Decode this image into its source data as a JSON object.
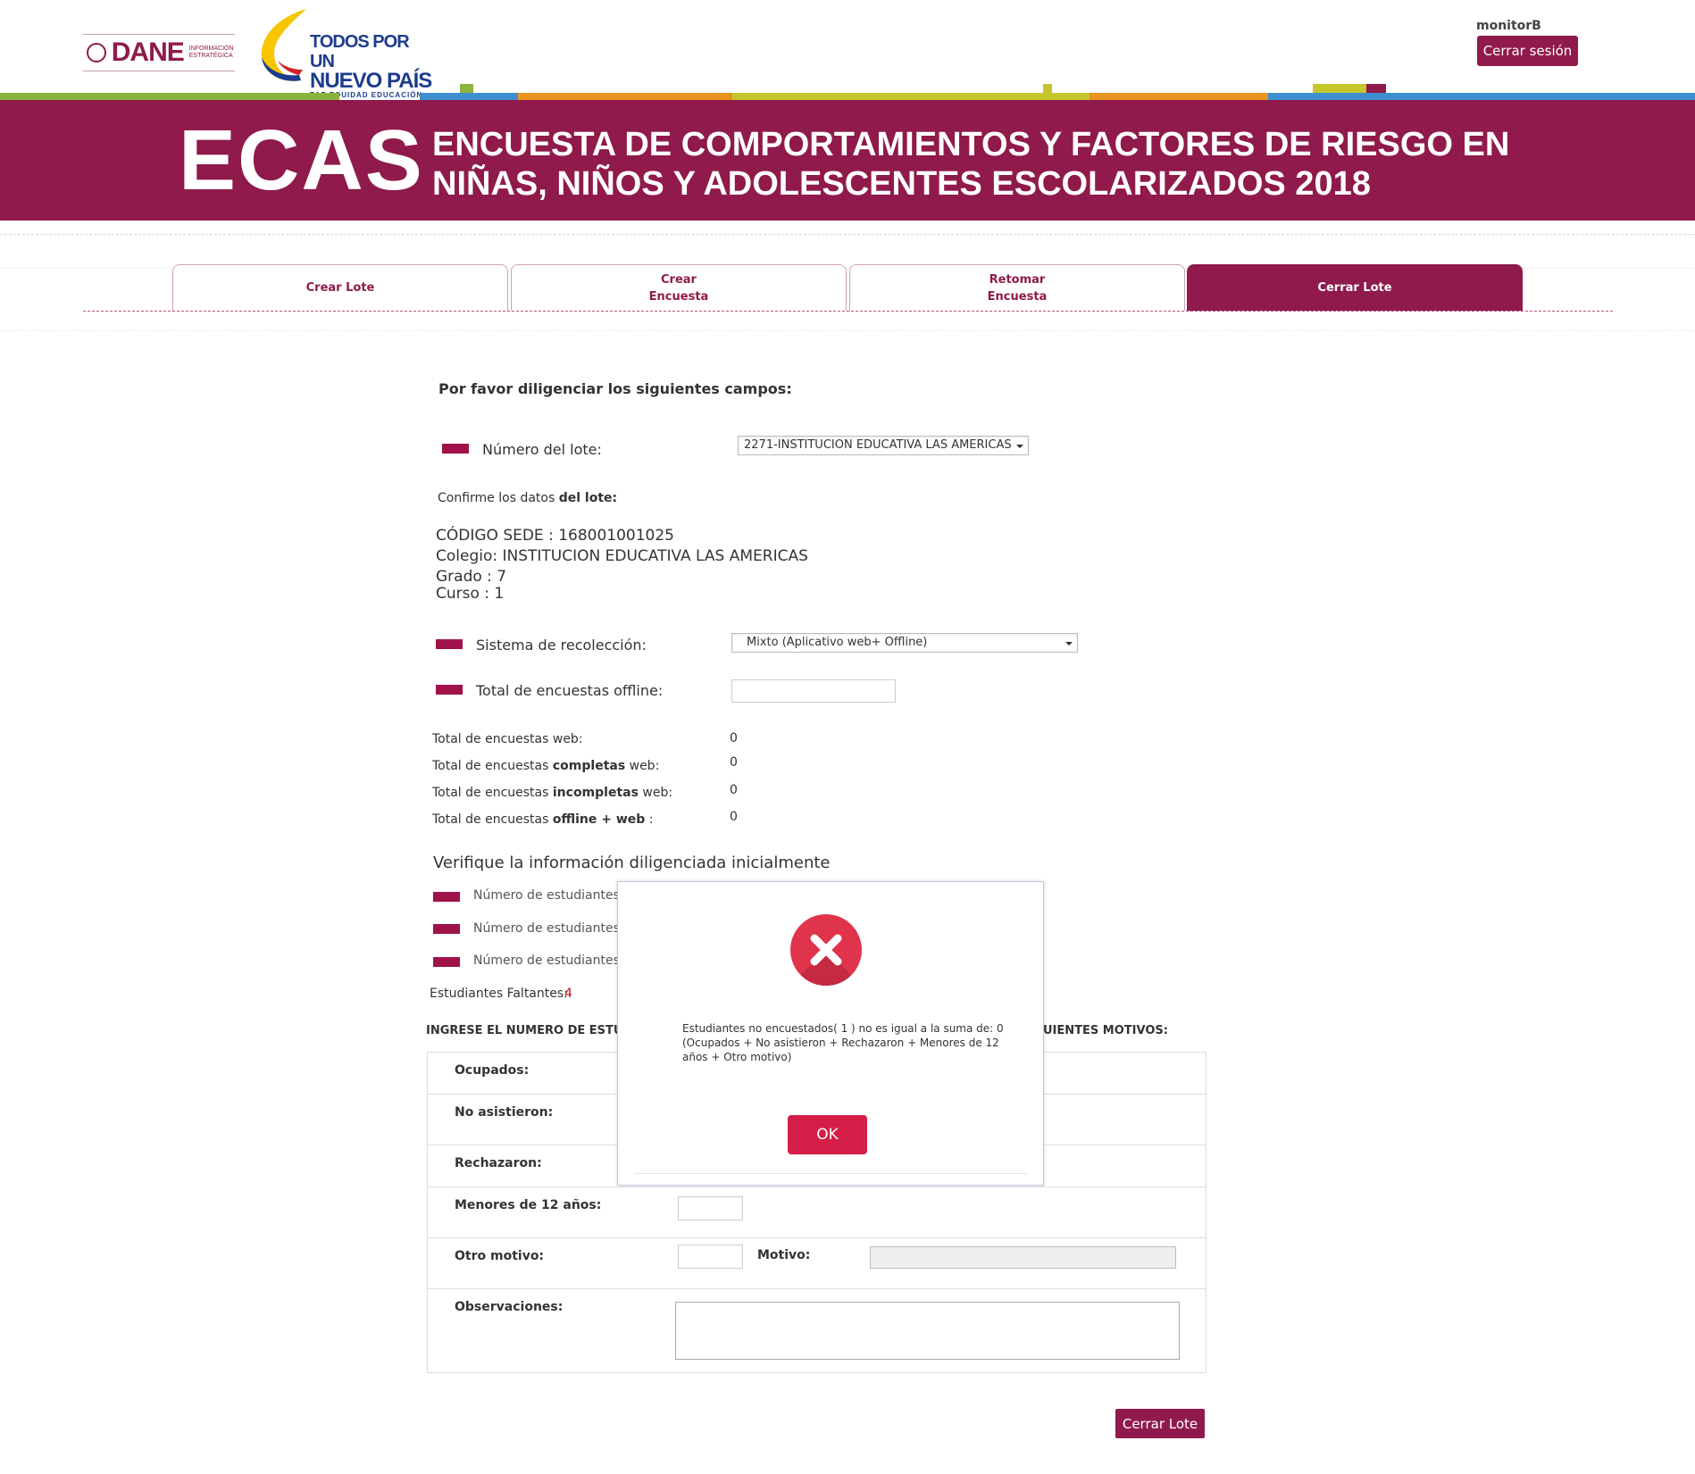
{
  "header": {
    "user": "monitorB",
    "logout_label": "Cerrar sesión",
    "dane_logo": {
      "name": "DANE",
      "sub": "INFORMACIÓN ESTRATÉGICA"
    },
    "gov_logo": {
      "line1": "TODOS POR UN",
      "line2": "NUEVO PAÍS",
      "line3": "PAZ  EQUIDAD  EDUCACIÓN"
    },
    "banner_short": "ECAS",
    "banner_title": "ENCUESTA DE COMPORTAMIENTOS Y FACTORES DE RIESGO EN NIÑAS, NIÑOS Y ADOLESCENTES ESCOLARIZADOS 2018"
  },
  "tabs": [
    {
      "label": "Crear Lote",
      "active": false
    },
    {
      "label": "Crear Encuesta",
      "active": false
    },
    {
      "label": "Retomar Encuesta",
      "active": false
    },
    {
      "label": "Cerrar Lote",
      "active": true
    }
  ],
  "form": {
    "intro": "Por favor diligenciar los siguientes campos:",
    "lote_label": "Número del lote:",
    "lote_value": "2271-INSTITUCION EDUCATIVA LAS AMERICAS",
    "confirm_prefix": "Confirme los datos ",
    "confirm_bold": "del lote:",
    "codigo_sede": "CÓDIGO SEDE : 168001001025",
    "colegio": "Colegio: INSTITUCION EDUCATIVA LAS AMERICAS",
    "grado": "Grado : 7",
    "curso": "Curso : 1",
    "sistema_label": "Sistema de recolección:",
    "sistema_value": "Mixto (Aplicativo web+ Offline)",
    "offline_label": "Total de encuestas offline:",
    "totals": [
      {
        "prefix": "Total de encuestas web:",
        "bold": "",
        "suffix": "",
        "value": "0"
      },
      {
        "prefix": "Total de encuestas ",
        "bold": "completas",
        "suffix": " web:",
        "value": "0"
      },
      {
        "prefix": "Total de encuestas ",
        "bold": "incompletas",
        "suffix": " web:",
        "value": "0"
      },
      {
        "prefix": "Total de encuestas ",
        "bold": "offline + web",
        "suffix": " :",
        "value": "0"
      }
    ],
    "verify_title": "Verifique la información diligenciada inicialmente",
    "verify_items": [
      "Número de estudiantes",
      "Número de estudiantes",
      "Número de estudiantes"
    ],
    "faltantes_label": "Estudiantes Faltantes:",
    "faltantes_value": "4",
    "motivos_left": "INGRESE EL NUMERO DE ESTUD",
    "motivos_right": "UIENTES MOTIVOS:",
    "motivos": [
      "Ocupados:",
      "No asistieron:",
      "Rechazaron:",
      "Menores de 12 años:",
      "Otro motivo:"
    ],
    "motivo_label": "Motivo:",
    "observaciones": "Observaciones:",
    "submit": "Cerrar Lote"
  },
  "modal": {
    "icon": "error-x-icon",
    "message": "Estudiantes no encuestados( 1 ) no es igual a la suma de: 0 (Ocupados + No asistieron + Rechazaron + Menores de 12 años + Otro motivo)",
    "ok": "OK"
  },
  "colors": {
    "brand": "#8f1a4b",
    "error": "#e0344c",
    "ok_button": "#d51f48"
  }
}
